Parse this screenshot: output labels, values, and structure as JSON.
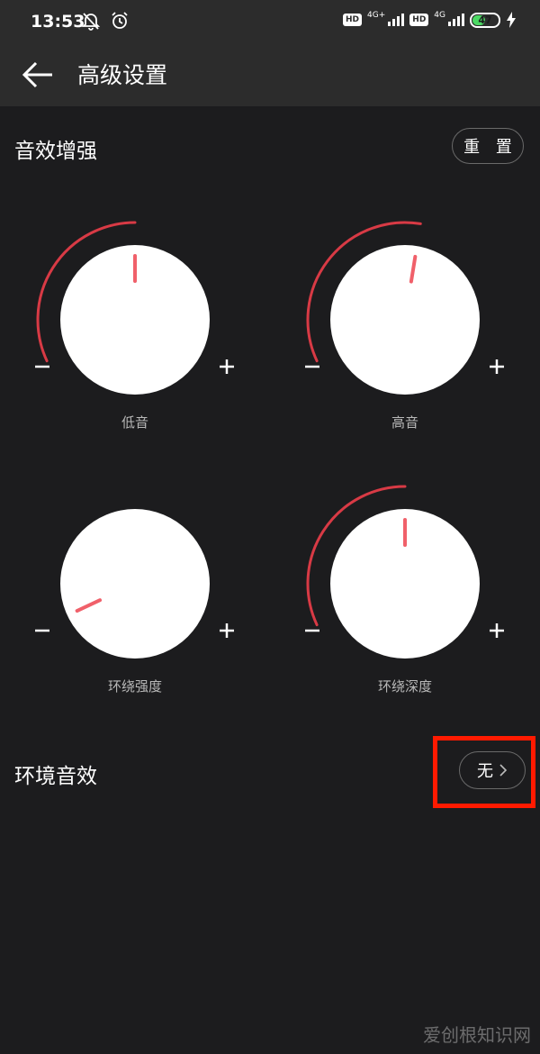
{
  "status_bar": {
    "time": "13:53",
    "network_1": "4G+",
    "network_2": "4G",
    "hd_label": "HD",
    "battery": "47",
    "battery_level": 0.47,
    "icons": [
      "mute-bell-icon",
      "alarm-clock-icon",
      "signal-icon",
      "battery-icon",
      "charging-bolt-icon"
    ]
  },
  "app_bar": {
    "title": "高级设置",
    "back_icon": "arrow-left-icon"
  },
  "sound_enhancement": {
    "title": "音效增强",
    "reset_label": "重 置",
    "knobs": [
      {
        "label": "低音",
        "value": 0.5
      },
      {
        "label": "高音",
        "value": 0.54
      },
      {
        "label": "环绕强度",
        "value": 0.0
      },
      {
        "label": "环绕深度",
        "value": 0.5
      }
    ],
    "minus_symbol": "−",
    "plus_symbol": "+"
  },
  "ambient_effect": {
    "label": "环境音效",
    "value": "无",
    "chevron": "›"
  },
  "watermark": "爱创根知识网",
  "colors": {
    "background": "#1c1c1e",
    "header": "#2c2c2c",
    "accent_red": "#d83a45",
    "indicator": "#f0606a",
    "highlight_box": "#ff1a00",
    "battery_green": "#4cd964"
  }
}
